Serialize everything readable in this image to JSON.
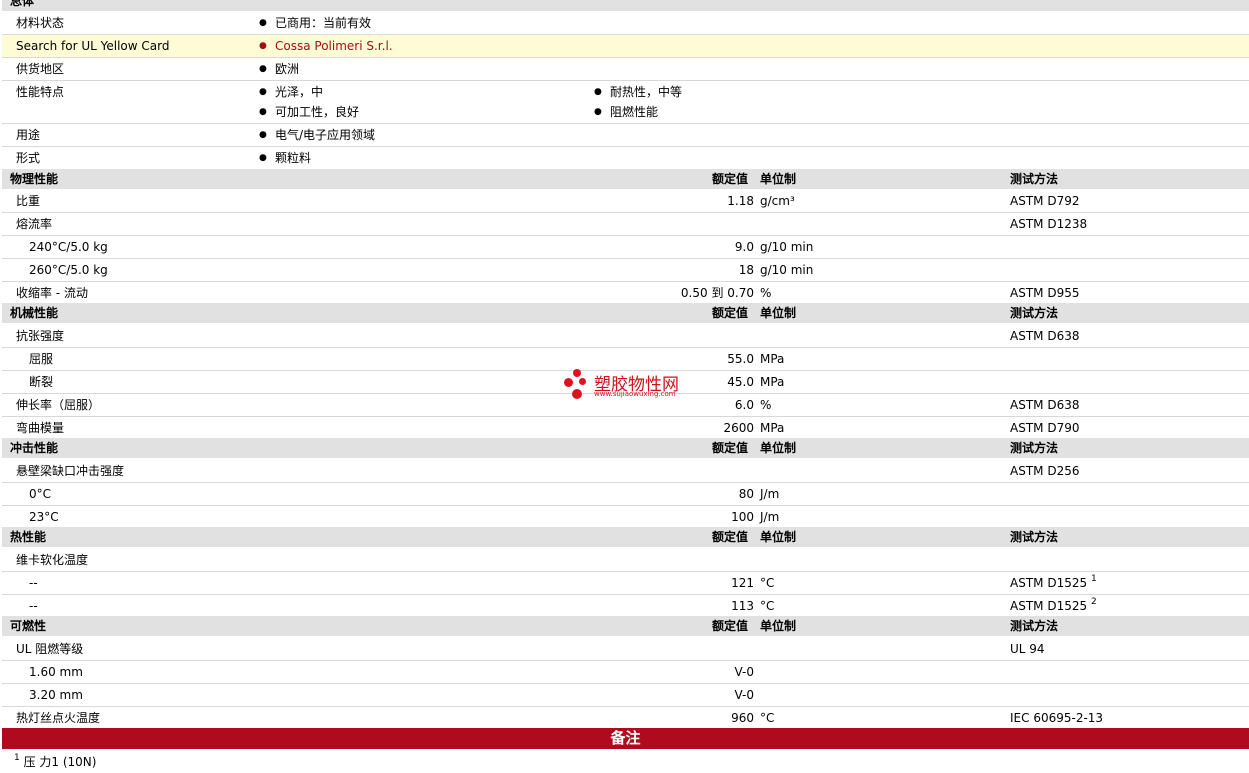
{
  "general": {
    "header": "总体",
    "rows": [
      {
        "label": "材料状态",
        "values": [
          "已商用：当前有效"
        ]
      },
      {
        "label": "Search for UL Yellow Card",
        "values": [
          "Cossa Polimeri S.r.l."
        ]
      },
      {
        "label": "供货地区",
        "values": [
          "欧洲"
        ]
      },
      {
        "label": "性能特点",
        "values": [
          "光泽，中",
          "耐热性，中等",
          "可加工性，良好",
          "阻燃性能"
        ]
      },
      {
        "label": "用途",
        "values": [
          "电气/电子应用领域"
        ]
      },
      {
        "label": "形式",
        "values": [
          "颗粒料"
        ]
      }
    ]
  },
  "col_headers": {
    "rated": "额定值",
    "unit": "单位制",
    "method": "测试方法"
  },
  "physical": {
    "header": "物理性能",
    "rows": [
      {
        "label": "比重",
        "value": "1.18",
        "unit": "g/cm³",
        "method": "ASTM D792"
      },
      {
        "label": "熔流率",
        "value": "",
        "unit": "",
        "method": "ASTM D1238"
      },
      {
        "label": "240°C/5.0 kg",
        "value": "9.0",
        "unit": "g/10 min",
        "method": ""
      },
      {
        "label": "260°C/5.0 kg",
        "value": "18",
        "unit": "g/10 min",
        "method": ""
      },
      {
        "label": "收缩率  - 流动",
        "value": "0.50 到  0.70",
        "unit": "%",
        "method": "ASTM D955"
      }
    ]
  },
  "mechanical": {
    "header": "机械性能",
    "rows": [
      {
        "label": "抗张强度",
        "value": "",
        "unit": "",
        "method": "ASTM D638"
      },
      {
        "label": "屈服",
        "value": "55.0",
        "unit": "MPa",
        "method": ""
      },
      {
        "label": "断裂",
        "value": "45.0",
        "unit": "MPa",
        "method": ""
      },
      {
        "label": "伸长率（屈服）",
        "value": "6.0",
        "unit": "%",
        "method": "ASTM D638"
      },
      {
        "label": "弯曲模量",
        "value": "2600",
        "unit": "MPa",
        "method": "ASTM D790"
      }
    ]
  },
  "impact": {
    "header": "冲击性能",
    "rows": [
      {
        "label": "悬壁梁缺口冲击强度",
        "value": "",
        "unit": "",
        "method": "ASTM D256"
      },
      {
        "label": "0°C",
        "value": "80",
        "unit": "J/m",
        "method": ""
      },
      {
        "label": "23°C",
        "value": "100",
        "unit": "J/m",
        "method": ""
      }
    ]
  },
  "thermal": {
    "header": "热性能",
    "rows": [
      {
        "label": "维卡软化温度",
        "value": "",
        "unit": "",
        "method": ""
      },
      {
        "label": "--",
        "value": "121",
        "unit": "°C",
        "method": "ASTM D1525",
        "note": "1"
      },
      {
        "label": "--",
        "value": "113",
        "unit": "°C",
        "method": "ASTM D1525",
        "note": "2"
      }
    ]
  },
  "flammability": {
    "header": "可燃性",
    "rows": [
      {
        "label": "UL 阻燃等级",
        "value": "",
        "unit": "",
        "method": "UL 94"
      },
      {
        "label": "1.60 mm",
        "value": "V-0",
        "unit": "",
        "method": ""
      },
      {
        "label": "3.20 mm",
        "value": "V-0",
        "unit": "",
        "method": ""
      },
      {
        "label": "热灯丝点火温度",
        "value": "960",
        "unit": "°C",
        "method": "IEC 60695-2-13"
      }
    ]
  },
  "notes": {
    "header": "备注",
    "items": [
      {
        "num": "1",
        "text": "压  力1 (10N)"
      }
    ]
  },
  "watermark": {
    "text": "塑胶物性网",
    "url": "www.sujiaowuxing.com"
  },
  "colors": {
    "accent": "#b00a1f",
    "section_bg": "#e1e1e1",
    "highlight": "#fffbd5",
    "link": "#a01010"
  }
}
